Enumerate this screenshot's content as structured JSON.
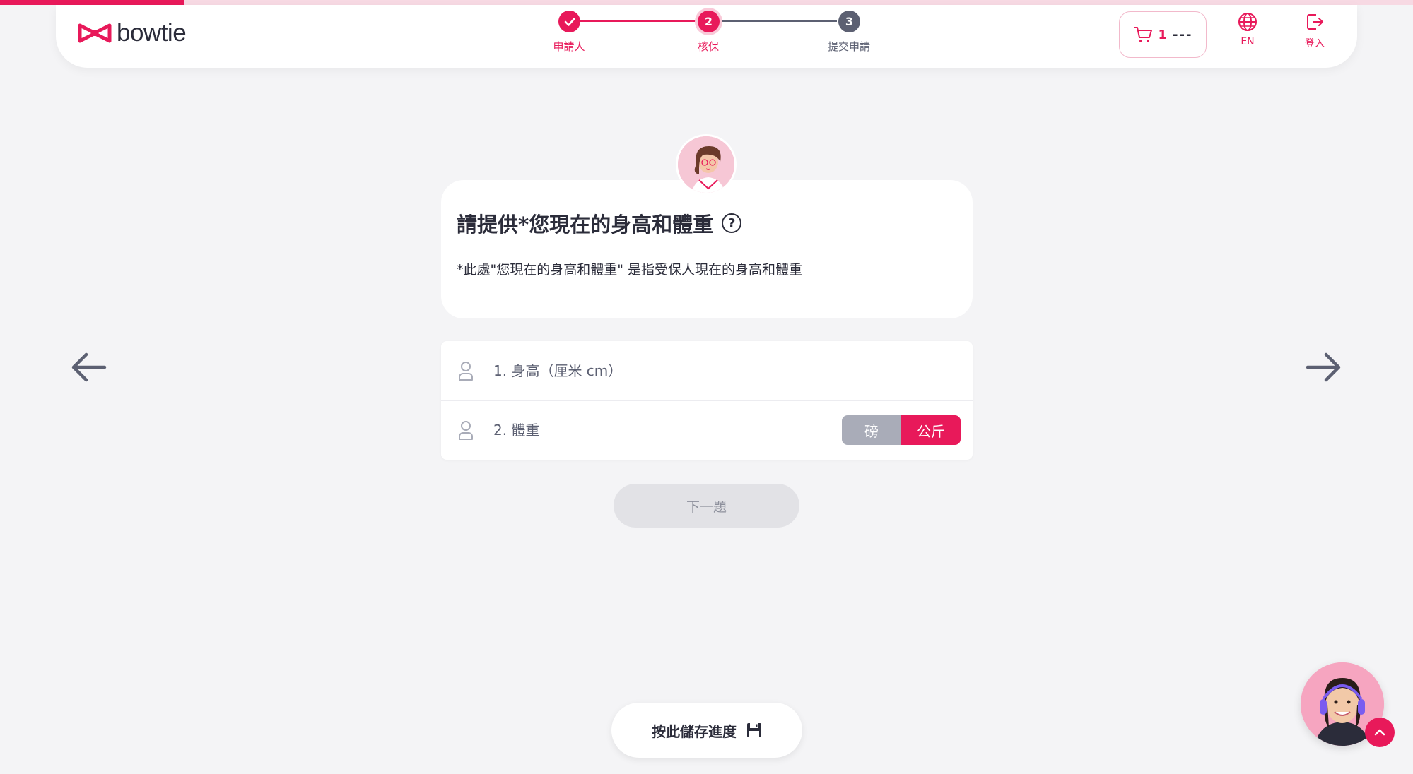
{
  "brand": {
    "name": "bowtie",
    "accent": "#e8195a"
  },
  "steps": [
    {
      "label": "申請人",
      "number": "",
      "state": "done"
    },
    {
      "label": "核保",
      "number": "2",
      "state": "current"
    },
    {
      "label": "提交申請",
      "number": "3",
      "state": "upcoming"
    }
  ],
  "header": {
    "cart_count": "1",
    "cart_amount": "---",
    "language_label": "EN",
    "login_label": "登入"
  },
  "question": {
    "title": "請提供*您現在的身高和體重",
    "help_icon_text": "?",
    "note": "*此處\"您現在的身高和體重\" 是指受保人現在的身高和體重"
  },
  "form": {
    "height_placeholder": "1. 身高（厘米 cm）",
    "height_value": "",
    "weight_placeholder": "2. 體重",
    "weight_value": "",
    "unit_options": [
      "磅",
      "公斤"
    ],
    "unit_selected": "公斤"
  },
  "buttons": {
    "next_label": "下一題",
    "save_label": "按此儲存進度"
  },
  "progress_fraction": 0.13
}
